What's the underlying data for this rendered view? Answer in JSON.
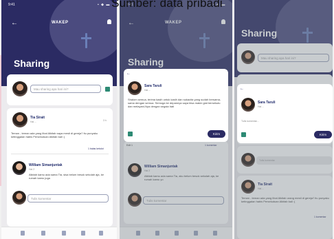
{
  "caption": "Sumber: data pribadi",
  "status_time": "9:41",
  "app_title": "Sharing",
  "logo_text": "WAKEP",
  "colors": {
    "primary": "#2b2b63",
    "accent_green": "#2d8a74",
    "card": "#ffffff"
  },
  "screen1": {
    "input_placeholder": "Mau sharing apa hari ini?",
    "post1": {
      "name": "Tia Sirait",
      "meta": "Hai ...",
      "time": "3 h",
      "text": "Teman - teman ada yang lihat Alkitab saya mesti di gereja? itu punyaku ketinggalan habis Persekutuan Alkitab kali :(",
      "reply_link": "1 balas ketulut"
    },
    "post2": {
      "name": "William Simanjuntak",
      "meta": "Hai 2",
      "text": "Alkitab kamu ada sama Tia, sisa belum besok sekolah aja, ke rumah kamu juga"
    },
    "reply_placeholder": "Tulis komentar"
  },
  "screen2": {
    "post": {
      "name": "Sara Taruli",
      "meta": "Hai ...",
      "text": "Shalom semua, terima kasih untuk kasih dan sukacita yang sudah bersama-sama dengan semua. Semoga ke depannya saya bisa makin giat bersekutu dan melayani-Nya dengan segala hati"
    },
    "send_label": "Kirim",
    "section_label": "Edit 1",
    "section_link": "1 komentar",
    "post2": {
      "name": "William Simanjuntak",
      "meta": "Hai 2",
      "text": "Alkitab kamu ada sama Tia, aku belum besok sekolah aja, ke rumah kamu yo"
    },
    "reply_placeholder": "Tulis komentar"
  },
  "screen3": {
    "input_placeholder": "Mau sharing apa hari ini?",
    "post": {
      "name": "Sara Taruli",
      "meta": "Hai ...",
      "comment_placeholder": "Tulis komentar..."
    },
    "send_label": "Kirim",
    "reply_placeholder": "Tulis komentar",
    "post2": {
      "name": "Tia Sirait",
      "meta": "Hai ...",
      "text": "Teman - teman ada yang lihat Alkitab orang mesti di gereja? itu punyaku ketinggalan habis Persekutuan Alkitab kali :(",
      "reply_link": "1 komentar"
    }
  }
}
